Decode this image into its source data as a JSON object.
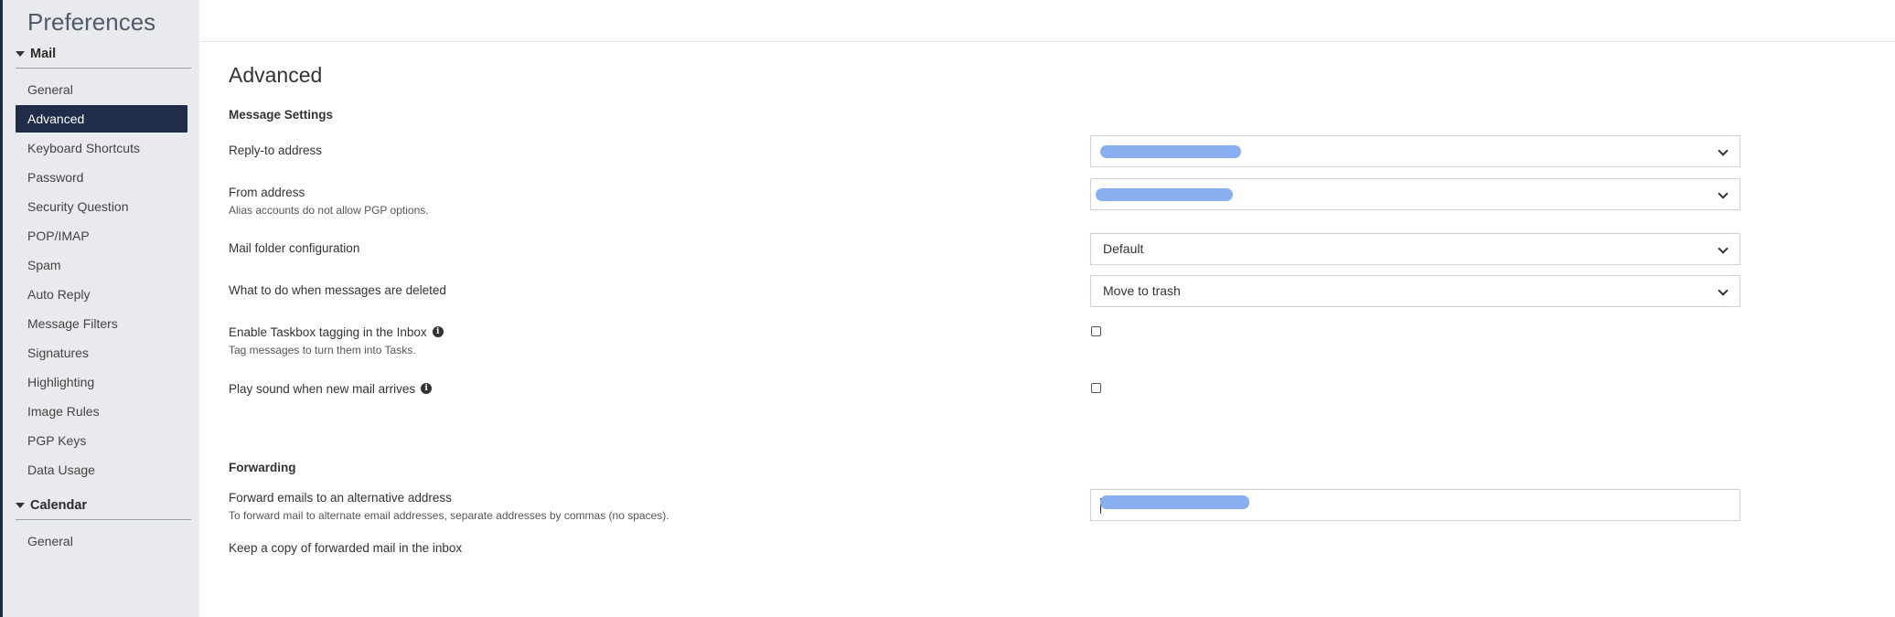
{
  "sidebar": {
    "title": "Preferences",
    "sections": [
      {
        "label": "Mail",
        "items": [
          {
            "label": "General"
          },
          {
            "label": "Advanced",
            "active": true
          },
          {
            "label": "Keyboard Shortcuts"
          },
          {
            "label": "Password"
          },
          {
            "label": "Security Question"
          },
          {
            "label": "POP/IMAP"
          },
          {
            "label": "Spam"
          },
          {
            "label": "Auto Reply"
          },
          {
            "label": "Message Filters"
          },
          {
            "label": "Signatures"
          },
          {
            "label": "Highlighting"
          },
          {
            "label": "Image Rules"
          },
          {
            "label": "PGP Keys"
          },
          {
            "label": "Data Usage"
          }
        ]
      },
      {
        "label": "Calendar",
        "items": [
          {
            "label": "General"
          }
        ]
      }
    ]
  },
  "main": {
    "title": "Advanced",
    "message_settings": {
      "title": "Message Settings",
      "reply_to": {
        "label": "Reply-to address",
        "value": "",
        "redacted": true
      },
      "from": {
        "label": "From address",
        "sub": "Alias accounts do not allow PGP options.",
        "value": "",
        "redacted": true
      },
      "folder_config": {
        "label": "Mail folder configuration",
        "value": "Default"
      },
      "on_delete": {
        "label": "What to do when messages are deleted",
        "value": "Move to trash"
      },
      "taskbox": {
        "label": "Enable Taskbox tagging in the Inbox",
        "sub": "Tag messages to turn them into Tasks.",
        "checked": false,
        "info_icon": "info-icon"
      },
      "sound": {
        "label": "Play sound when new mail arrives",
        "checked": false,
        "info_icon": "info-icon"
      }
    },
    "forwarding": {
      "title": "Forwarding",
      "forward_to": {
        "label": "Forward emails to an alternative address",
        "sub": "To forward mail to alternate email addresses, separate addresses by commas (no spaces).",
        "value": "",
        "redacted": true
      },
      "keep_copy": {
        "label": "Keep a copy of forwarded mail in the inbox"
      }
    }
  },
  "colors": {
    "sidebar_bg": "#e9eaed",
    "active_item_bg": "#1f2d4a",
    "redaction": "#8aaff0"
  }
}
